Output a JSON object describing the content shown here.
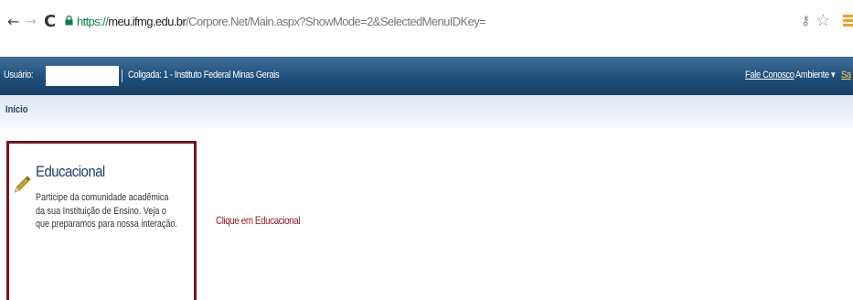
{
  "browser": {
    "url_scheme": "https://",
    "url_host": "meu.ifmg.edu.br",
    "url_path": "/Corpore.Net/Main.aspx?ShowMode=2&SelectedMenuIDKey=",
    "back_icon": "←",
    "forward_icon": "→",
    "reload_icon": "C",
    "key_icon": "⚷",
    "star_icon": "☆"
  },
  "topbar": {
    "usuario_label": "Usuário:",
    "usuario_value": "",
    "coligada": "Coligada: 1 - Instituto Federal Minas Gerais",
    "fale_conosco": "Fale Conosco",
    "ambiente": "Ambiente ▾",
    "sair": "Sa"
  },
  "breadcrumb": {
    "inicio": "Início"
  },
  "module": {
    "title": "Educacional",
    "description": "Participe da comunidade acadêmica da sua Instituição de Ensino. Veja o que preparamos para nossa interação."
  },
  "instruction": "Clique em Educacional",
  "colors": {
    "topbar": "#1f4e79",
    "card_border": "#7a1422",
    "instruction": "#9b1b20"
  }
}
